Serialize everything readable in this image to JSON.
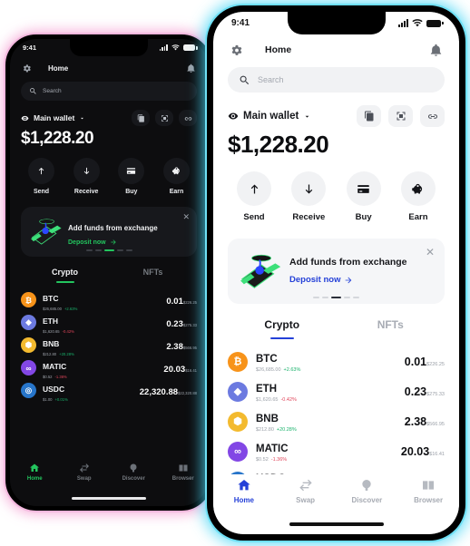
{
  "theme": {
    "light_accent": "#2440d8",
    "dark_accent": "#23c55e",
    "light_glow": "#6fe0f5",
    "dark_glow": "#f3b8de",
    "up_color": "#19b26b",
    "down_color": "#e0455a"
  },
  "status_bar": {
    "time": "9:41"
  },
  "header": {
    "title": "Home",
    "settings_icon": "gear-icon",
    "notification_icon": "bell-icon"
  },
  "search": {
    "placeholder": "Search",
    "icon": "search-icon"
  },
  "wallet": {
    "name": "Main wallet",
    "eye_icon": "eye-icon",
    "chevron_icon": "chevron-down-icon",
    "balance": "$1,228.20",
    "actions": [
      {
        "name": "copy-address-button",
        "icon": "copy-icon"
      },
      {
        "name": "scan-qr-button",
        "icon": "scan-icon"
      },
      {
        "name": "connect-button",
        "icon": "link-icon"
      }
    ]
  },
  "quick_actions": [
    {
      "label": "Send",
      "icon": "arrow-up-icon"
    },
    {
      "label": "Receive",
      "icon": "arrow-down-icon"
    },
    {
      "label": "Buy",
      "icon": "credit-card-icon"
    },
    {
      "label": "Earn",
      "icon": "piggy-bank-icon"
    }
  ],
  "promo": {
    "title": "Add funds from exchange",
    "cta": "Deposit now",
    "cta_arrow": "arrow-right-icon",
    "close_label": "✕",
    "dots_total": 5,
    "dots_active_index": 2
  },
  "tabs": [
    {
      "label": "Crypto",
      "active": true
    },
    {
      "label": "NFTs",
      "active": false
    }
  ],
  "tokens": [
    {
      "symbol": "BTC",
      "glyph": "₿",
      "color": "#f7931a",
      "price": "$26,685.00",
      "change": "+2.63%",
      "direction": "up",
      "amount": "0.01",
      "fiat": "$226.25"
    },
    {
      "symbol": "ETH",
      "glyph": "◆",
      "color": "#6c7ae0",
      "price": "$1,620.65",
      "change": "-0.42%",
      "direction": "down",
      "amount": "0.23",
      "fiat": "$275.33"
    },
    {
      "symbol": "BNB",
      "glyph": "⬢",
      "color": "#f3ba2f",
      "price": "$212.80",
      "change": "+20.28%",
      "direction": "up",
      "amount": "2.38",
      "fiat": "$566.95"
    },
    {
      "symbol": "MATIC",
      "glyph": "∞",
      "color": "#8247e5",
      "price": "$0.52",
      "change": "-1.36%",
      "direction": "down",
      "amount": "20.03",
      "fiat": "$16.41"
    },
    {
      "symbol": "USDC",
      "glyph": "◎",
      "color": "#2775ca",
      "price": "$1.00",
      "change": "+0.01%",
      "direction": "up",
      "amount": "22,320.88",
      "fiat": "$22,320.88"
    }
  ],
  "bottom_nav": [
    {
      "label": "Home",
      "icon": "home-icon",
      "active": true
    },
    {
      "label": "Swap",
      "icon": "swap-icon",
      "active": false
    },
    {
      "label": "Discover",
      "icon": "compass-icon",
      "active": false
    },
    {
      "label": "Browser",
      "icon": "browser-icon",
      "active": false
    }
  ]
}
